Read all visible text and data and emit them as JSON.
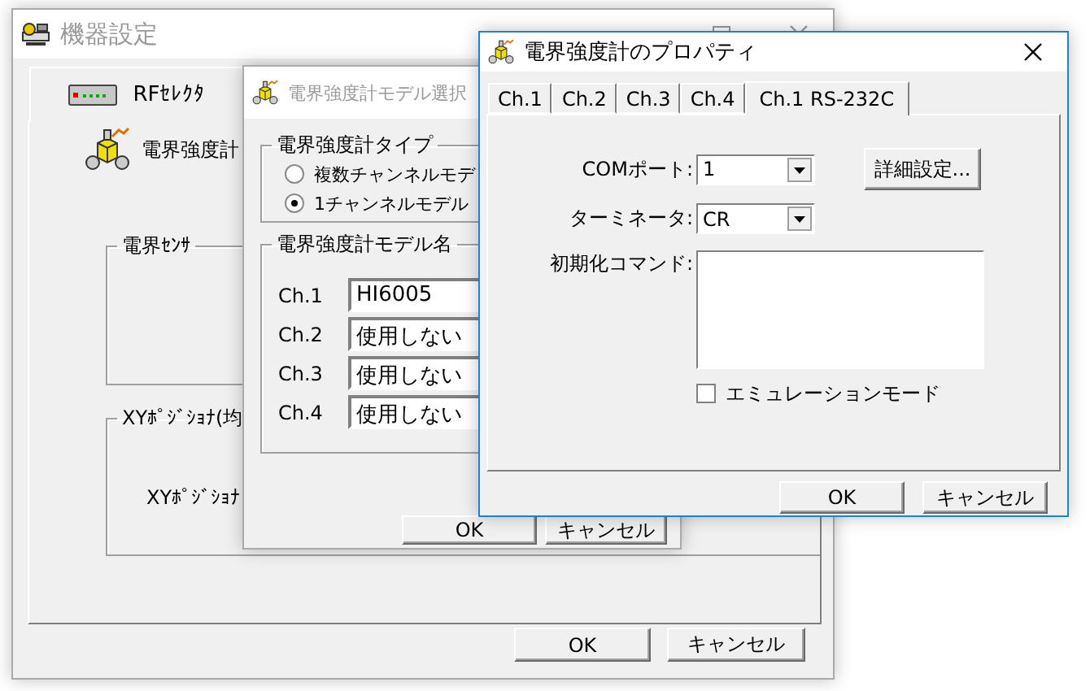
{
  "main_window": {
    "title": "機器設定",
    "active": false,
    "tabs": [
      {
        "label": "RFｾﾚｸﾀ",
        "selected": true
      }
    ],
    "device_label": "電界強度計",
    "groups": [
      {
        "title": "電界ｾﾝｻ"
      },
      {
        "title": "XYﾎﾟｼﾞｼｮﾅ(均",
        "label": "XYﾎﾟｼﾞｼｮﾅ"
      }
    ],
    "buttons": [
      "OK",
      "キャンセル"
    ]
  },
  "model_dialog": {
    "title": "電界強度計モデル選択",
    "active": false,
    "type_group": {
      "title": "電界強度計タイプ",
      "options": [
        {
          "label": "複数チャンネルモデ",
          "selected": false
        },
        {
          "label": "1チャンネルモデル",
          "selected": true
        }
      ]
    },
    "model_group": {
      "title": "電界強度計モデル名",
      "rows": [
        {
          "label": "Ch.1",
          "value": "HI6005"
        },
        {
          "label": "Ch.2",
          "value": "使用しない"
        },
        {
          "label": "Ch.3",
          "value": "使用しない"
        },
        {
          "label": "Ch.4",
          "value": "使用しない"
        }
      ]
    },
    "buttons": [
      "OK",
      "キャンセル"
    ]
  },
  "properties_dialog": {
    "title": "電界強度計のプロパティ",
    "active": true,
    "tabs": [
      {
        "label": "Ch.1",
        "selected": false
      },
      {
        "label": "Ch.2",
        "selected": false
      },
      {
        "label": "Ch.3",
        "selected": false
      },
      {
        "label": "Ch.4",
        "selected": false
      },
      {
        "label": "Ch.1 RS-232C",
        "selected": true
      }
    ],
    "com_port": {
      "label": "COMポート:",
      "value": "1"
    },
    "detail_button": "詳細設定...",
    "terminator": {
      "label": "ターミネータ:",
      "value": "CR"
    },
    "init_command": {
      "label": "初期化コマンド:"
    },
    "emulation": {
      "label": "エミュレーションモード",
      "checked": false
    },
    "buttons": [
      "OK",
      "キャンセル"
    ]
  }
}
